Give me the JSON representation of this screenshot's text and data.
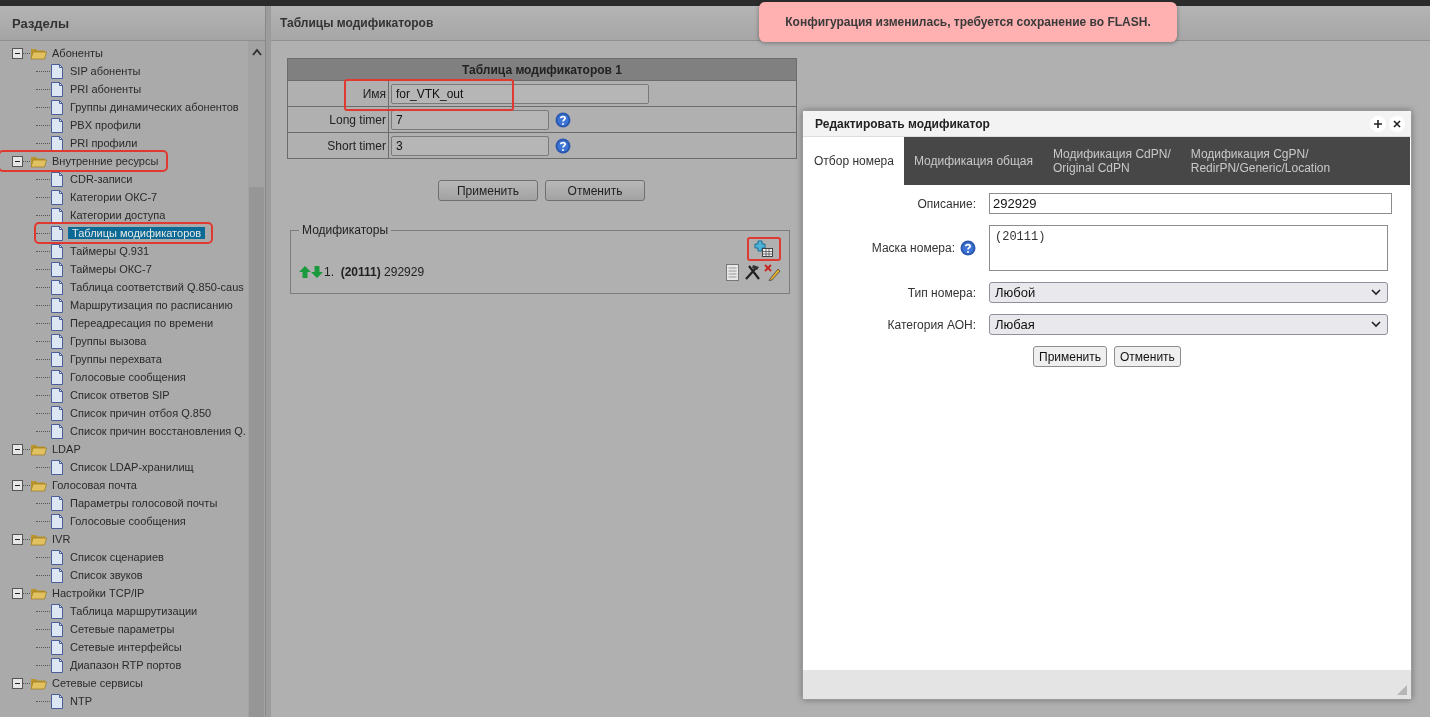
{
  "sidebar": {
    "title": "Разделы",
    "tree": [
      {
        "label": "Абоненты",
        "kind": "folder",
        "expanded": true,
        "selected": false,
        "highlighted": false,
        "children": [
          {
            "label": "SIP абоненты",
            "kind": "page",
            "selected": false,
            "highlighted": false
          },
          {
            "label": "PRI абоненты",
            "kind": "page",
            "selected": false,
            "highlighted": false
          },
          {
            "label": "Группы динамических абонентов",
            "kind": "page",
            "selected": false,
            "highlighted": false
          },
          {
            "label": "PBX профили",
            "kind": "page",
            "selected": false,
            "highlighted": false
          },
          {
            "label": "PRI профили",
            "kind": "page",
            "selected": false,
            "highlighted": false
          }
        ]
      },
      {
        "label": "Внутренние ресурсы",
        "kind": "folder",
        "expanded": true,
        "selected": false,
        "highlighted": true,
        "children": [
          {
            "label": "CDR-записи",
            "kind": "page",
            "selected": false,
            "highlighted": false
          },
          {
            "label": "Категории ОКС-7",
            "kind": "page",
            "selected": false,
            "highlighted": false
          },
          {
            "label": "Категории доступа",
            "kind": "page",
            "selected": false,
            "highlighted": false
          },
          {
            "label": "Таблицы модификаторов",
            "kind": "page",
            "selected": true,
            "highlighted": true
          },
          {
            "label": "Таймеры Q.931",
            "kind": "page",
            "selected": false,
            "highlighted": false
          },
          {
            "label": "Таймеры ОКС-7",
            "kind": "page",
            "selected": false,
            "highlighted": false
          },
          {
            "label": "Таблица соответствий Q.850-caus",
            "kind": "page",
            "selected": false,
            "highlighted": false
          },
          {
            "label": "Маршрутизация по расписанию",
            "kind": "page",
            "selected": false,
            "highlighted": false
          },
          {
            "label": "Переадресация по времени",
            "kind": "page",
            "selected": false,
            "highlighted": false
          },
          {
            "label": "Группы вызова",
            "kind": "page",
            "selected": false,
            "highlighted": false
          },
          {
            "label": "Группы перехвата",
            "kind": "page",
            "selected": false,
            "highlighted": false
          },
          {
            "label": "Голосовые сообщения",
            "kind": "page",
            "selected": false,
            "highlighted": false
          },
          {
            "label": "Список ответов SIP",
            "kind": "page",
            "selected": false,
            "highlighted": false
          },
          {
            "label": "Список причин отбоя Q.850",
            "kind": "page",
            "selected": false,
            "highlighted": false
          },
          {
            "label": "Список причин восстановления Q.",
            "kind": "page",
            "selected": false,
            "highlighted": false
          }
        ]
      },
      {
        "label": "LDAP",
        "kind": "folder",
        "expanded": true,
        "selected": false,
        "highlighted": false,
        "children": [
          {
            "label": "Список LDAP-хранилищ",
            "kind": "page",
            "selected": false,
            "highlighted": false
          }
        ]
      },
      {
        "label": "Голосовая почта",
        "kind": "folder",
        "expanded": true,
        "selected": false,
        "highlighted": false,
        "children": [
          {
            "label": "Параметры голосовой почты",
            "kind": "page",
            "selected": false,
            "highlighted": false
          },
          {
            "label": "Голосовые сообщения",
            "kind": "page",
            "selected": false,
            "highlighted": false
          }
        ]
      },
      {
        "label": "IVR",
        "kind": "folder",
        "expanded": true,
        "selected": false,
        "highlighted": false,
        "children": [
          {
            "label": "Список сценариев",
            "kind": "page",
            "selected": false,
            "highlighted": false
          },
          {
            "label": "Список звуков",
            "kind": "page",
            "selected": false,
            "highlighted": false
          }
        ]
      },
      {
        "label": "Настройки TCP/IP",
        "kind": "folder",
        "expanded": true,
        "selected": false,
        "highlighted": false,
        "children": [
          {
            "label": "Таблица маршрутизации",
            "kind": "page",
            "selected": false,
            "highlighted": false
          },
          {
            "label": "Сетевые параметры",
            "kind": "page",
            "selected": false,
            "highlighted": false
          },
          {
            "label": "Сетевые интерфейсы",
            "kind": "page",
            "selected": false,
            "highlighted": false
          },
          {
            "label": "Диапазон RTP портов",
            "kind": "page",
            "selected": false,
            "highlighted": false
          }
        ]
      },
      {
        "label": "Сетевые сервисы",
        "kind": "folder",
        "expanded": true,
        "selected": false,
        "highlighted": false,
        "children": [
          {
            "label": "NTP",
            "kind": "page",
            "selected": false,
            "highlighted": false
          }
        ]
      }
    ]
  },
  "main": {
    "title": "Таблицы модификаторов",
    "table": {
      "title": "Таблица модификаторов 1",
      "fields": [
        {
          "label": "Имя",
          "value": "for_VTK_out",
          "help": false,
          "highlighted": true
        },
        {
          "label": "Long timer",
          "value": "7",
          "help": true,
          "highlighted": false
        },
        {
          "label": "Short timer",
          "value": "3",
          "help": true,
          "highlighted": false
        }
      ]
    },
    "buttons": [
      "Применить",
      "Отменить"
    ],
    "modifiers": {
      "legend": "Модификаторы",
      "add_highlighted": true,
      "items": [
        {
          "text": "1.  **(20111)** 292929"
        }
      ]
    }
  },
  "notification": {
    "text": "Конфигурация изменилась, требуется сохранение во FLASH."
  },
  "dialog": {
    "title": "Редактировать модификатор",
    "tabs": [
      {
        "label": "Отбор номера",
        "selected": true
      },
      {
        "label": "Модификация общая",
        "selected": false
      },
      {
        "label": "Модификация CdPN/\nOriginal CdPN",
        "selected": false
      },
      {
        "label": "Модификация CgPN/\nRedirPN/Generic/Location",
        "selected": false
      }
    ],
    "fields": [
      {
        "kind": "text",
        "label": "Описание:",
        "value": "292929"
      },
      {
        "kind": "textarea",
        "label": "Маска номера:",
        "value": "(20111)",
        "help": true
      },
      {
        "kind": "select",
        "label": "Тип номера:",
        "value": "Любой"
      },
      {
        "kind": "select",
        "label": "Категория АОН:",
        "value": "Любая"
      }
    ],
    "buttons": [
      "Применить",
      "Отменить"
    ]
  }
}
